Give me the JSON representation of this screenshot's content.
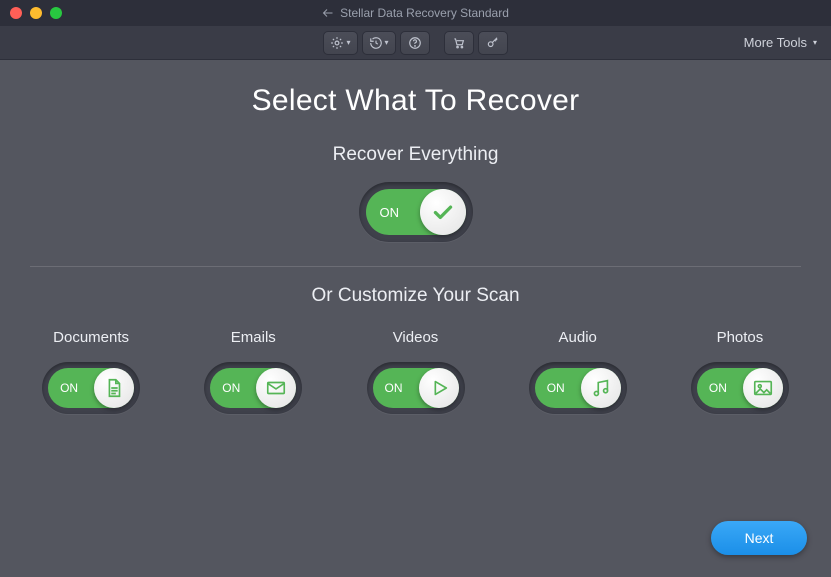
{
  "window": {
    "title": "Stellar Data Recovery Standard"
  },
  "toolbar": {
    "more_tools_label": "More Tools"
  },
  "page": {
    "title": "Select What To Recover",
    "recover_everything_label": "Recover Everything",
    "customize_label": "Or Customize Your Scan",
    "toggle_on_label": "ON",
    "next_label": "Next"
  },
  "main_toggle": {
    "state": "on",
    "label": "ON"
  },
  "categories": [
    {
      "name": "Documents",
      "state": "on",
      "label": "ON",
      "icon": "document"
    },
    {
      "name": "Emails",
      "state": "on",
      "label": "ON",
      "icon": "email"
    },
    {
      "name": "Videos",
      "state": "on",
      "label": "ON",
      "icon": "video"
    },
    {
      "name": "Audio",
      "state": "on",
      "label": "ON",
      "icon": "audio"
    },
    {
      "name": "Photos",
      "state": "on",
      "label": "ON",
      "icon": "photo"
    }
  ],
  "colors": {
    "accent_green": "#55b556",
    "accent_blue": "#1f97ef",
    "bg": "#54565f"
  }
}
